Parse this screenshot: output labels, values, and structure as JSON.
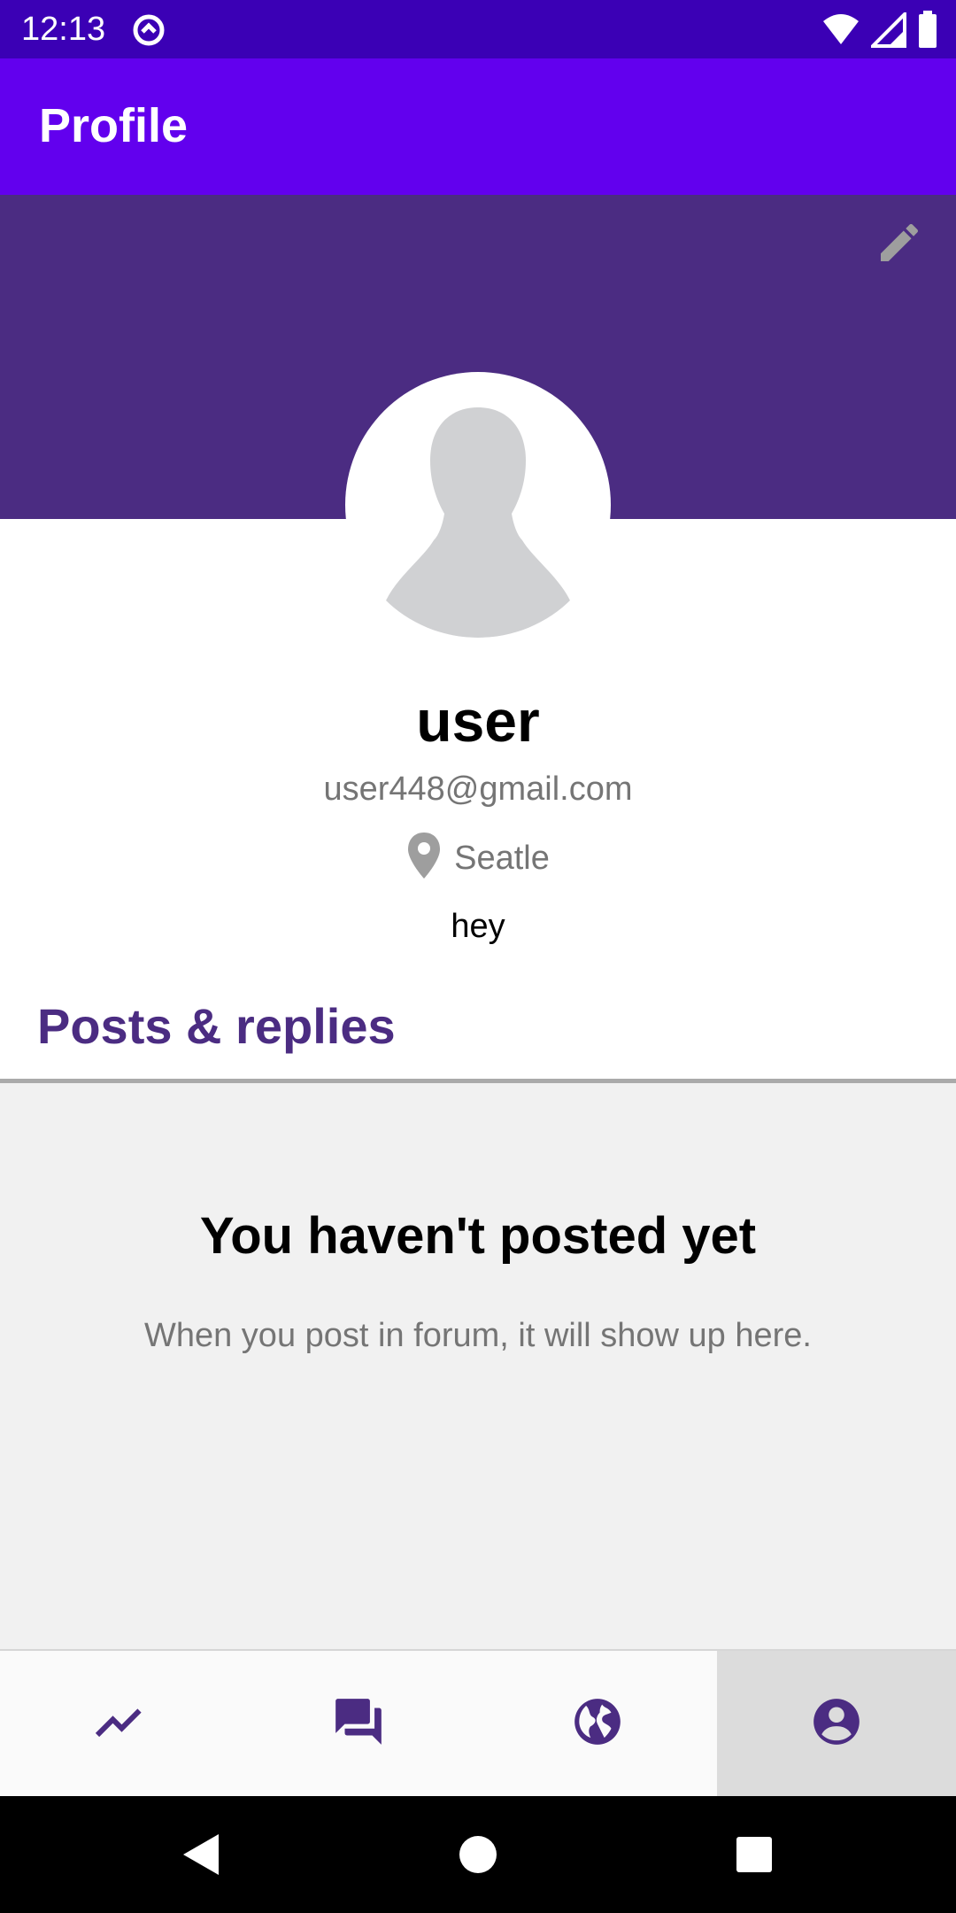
{
  "status_bar": {
    "time": "12:13",
    "icons": [
      "sync-icon",
      "wifi-icon",
      "signal-icon",
      "battery-icon"
    ]
  },
  "app_bar": {
    "title": "Profile"
  },
  "profile": {
    "name": "user",
    "email": "user448@gmail.com",
    "location": "Seatle",
    "bio": "hey"
  },
  "posts": {
    "section_title": "Posts & replies",
    "empty_title": "You haven't posted yet",
    "empty_subtitle": "When you post in forum, it will show up here."
  },
  "bottom_nav": {
    "items": [
      {
        "icon": "trending-icon",
        "active": false
      },
      {
        "icon": "forum-icon",
        "active": false
      },
      {
        "icon": "globe-icon",
        "active": false
      },
      {
        "icon": "account-icon",
        "active": true
      }
    ]
  },
  "system_nav": {
    "icons": [
      "back-icon",
      "home-icon",
      "recents-icon"
    ]
  },
  "colors": {
    "status_bar": "#3b00b5",
    "app_bar": "#6200ee",
    "cover": "#4b2c82",
    "accent": "#4b2c82",
    "empty_bg": "#f1f1f1"
  }
}
